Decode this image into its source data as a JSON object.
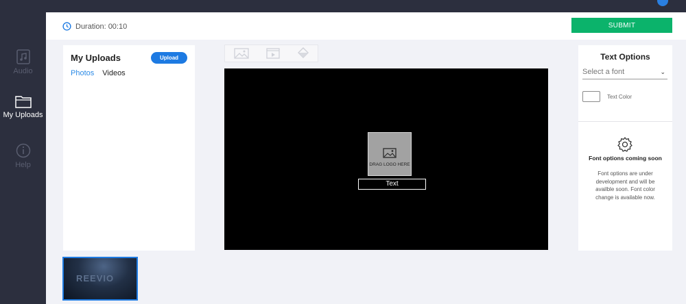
{
  "sidebar": {
    "items": [
      {
        "label": "Audio",
        "icon": "music-file-icon",
        "state": "inactive"
      },
      {
        "label": "My Uploads",
        "icon": "folder-icon",
        "state": "active"
      },
      {
        "label": "Help",
        "icon": "info-icon",
        "state": "inactive"
      }
    ]
  },
  "header": {
    "duration": "Duration: 00:10",
    "submit_label": "SUBMIT"
  },
  "uploads": {
    "title": "My Uploads",
    "upload_label": "Upload",
    "tabs": [
      {
        "label": "Photos",
        "active": true
      },
      {
        "label": "Videos",
        "active": false
      }
    ]
  },
  "toolbar": {
    "icons": [
      "image-icon",
      "video-icon",
      "paint-bucket-icon"
    ]
  },
  "canvas": {
    "logo_placeholder": "DRAG LOGO HERE",
    "text_label": "Text"
  },
  "text_options": {
    "title": "Text Options",
    "font_placeholder": "Select a font",
    "text_color_label": "Text Color",
    "coming_soon_title": "Font options coming soon",
    "coming_soon_desc": "Font options are under development and will be availble soon. Font color change is available now."
  },
  "timeline": {
    "thumbnail_text": "REEVIO"
  },
  "colors": {
    "sidebar_bg": "#2c2f3e",
    "accent_blue": "#1d7ae2",
    "submit_green": "#0bb36b",
    "canvas_bg": "#000000"
  }
}
